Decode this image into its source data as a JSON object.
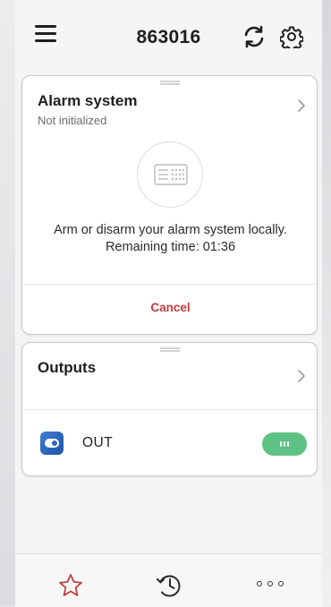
{
  "header": {
    "title": "863016",
    "menu_icon": "hamburger-menu-icon",
    "refresh_icon": "refresh-icon",
    "settings_icon": "gear-icon"
  },
  "alarm_card": {
    "title": "Alarm system",
    "status": "Not initialized",
    "icon": "keypad-icon",
    "message_line1": "Arm or disarm your alarm system locally.",
    "message_line2": "Remaining time: 01:36",
    "cancel_label": "Cancel",
    "cancel_color": "#c0393b"
  },
  "outputs_card": {
    "title": "Outputs",
    "items": [
      {
        "label": "OUT",
        "icon": "output-toggle-icon",
        "state": "on",
        "toggle_color": "#5dc283"
      }
    ]
  },
  "bottom_nav": {
    "items": [
      {
        "icon": "star-icon",
        "color": "#c0393b"
      },
      {
        "icon": "history-icon"
      },
      {
        "icon": "more-icon"
      }
    ]
  }
}
